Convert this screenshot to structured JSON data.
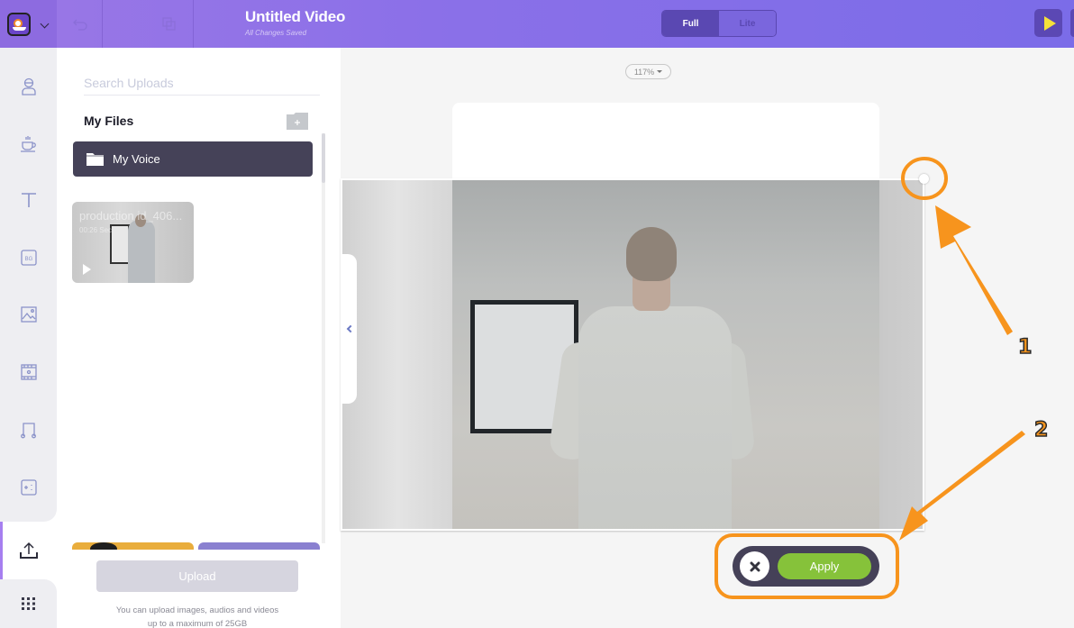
{
  "header": {
    "title": "Untitled Video",
    "save_status": "All Changes Saved",
    "modes": [
      {
        "label": "Full",
        "active": true
      },
      {
        "label": "Lite",
        "active": false
      }
    ],
    "icons": {
      "logo": "app-mascot-logo",
      "undo": "undo-icon",
      "duplicate": "duplicate-icon",
      "play": "play-icon"
    }
  },
  "rail": {
    "items": [
      {
        "name": "characters",
        "icon": "character-icon",
        "active": false
      },
      {
        "name": "properties",
        "icon": "coffee-cup-icon",
        "active": false
      },
      {
        "name": "text",
        "icon": "text-icon",
        "active": false
      },
      {
        "name": "backgrounds",
        "icon": "bg-icon",
        "label": "BG",
        "active": false
      },
      {
        "name": "images",
        "icon": "image-icon",
        "active": false
      },
      {
        "name": "videos",
        "icon": "video-icon",
        "active": false
      },
      {
        "name": "music",
        "icon": "music-icon",
        "active": false
      },
      {
        "name": "effects",
        "icon": "sparkle-icon",
        "active": false
      },
      {
        "name": "uploads",
        "icon": "upload-icon",
        "active": true
      },
      {
        "name": "more",
        "icon": "grid-icon",
        "active": false
      }
    ]
  },
  "uploads_panel": {
    "search_placeholder": "Search Uploads",
    "section_title": "My Files",
    "folders": [
      {
        "label": "My Voice",
        "icon": "folder-icon"
      }
    ],
    "files": [
      {
        "name": "production id_406...",
        "duration": "00:26 Sec",
        "type": "video"
      }
    ],
    "upload_button": "Upload",
    "upload_note_line1": "You can upload images, audios and videos",
    "upload_note_line2": "up to a maximum of 25GB"
  },
  "canvas": {
    "zoom_level": "117%",
    "actions": {
      "cancel_icon": "close-icon",
      "apply_label": "Apply"
    }
  },
  "annotations": [
    {
      "number": "1",
      "target": "resize-handle"
    },
    {
      "number": "2",
      "target": "apply-controls"
    }
  ],
  "colors": {
    "header_start": "#9a77e6",
    "header_end": "#7b6ce8",
    "accent_dark": "#5a48b2",
    "apply_green": "#86c23a",
    "annotation_orange": "#f7941d",
    "folder_row": "#454258"
  }
}
